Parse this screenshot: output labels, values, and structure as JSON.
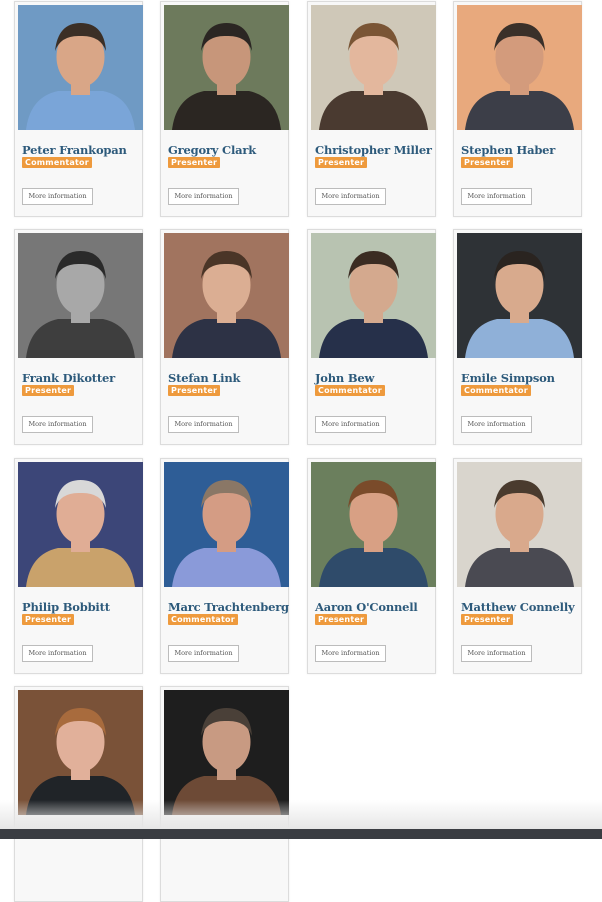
{
  "more_label": "More information",
  "colors": {
    "name": "#2d5a7b",
    "badge": "#ee9a3d",
    "footer": "#3a3d42"
  },
  "people": [
    {
      "name": "Peter Frankopan",
      "role": "Commentator",
      "bg": "#6f9ac4",
      "skin": "#d9a687",
      "hair": "#3b2f26",
      "shirt": "#7aa5d8"
    },
    {
      "name": "Gregory Clark",
      "role": "Presenter",
      "bg": "#6d7a5c",
      "skin": "#c7967a",
      "hair": "#2b2623",
      "shirt": "#2b2622"
    },
    {
      "name": "Christopher Miller",
      "role": "Presenter",
      "bg": "#cfc8b8",
      "skin": "#e3b79d",
      "hair": "#7a5535",
      "shirt": "#4a3a30"
    },
    {
      "name": "Stephen Haber",
      "role": "Presenter",
      "bg": "#e8a97d",
      "skin": "#d39b7c",
      "hair": "#3a3029",
      "shirt": "#3c3e48"
    },
    {
      "name": "Frank Dikotter",
      "role": "Presenter",
      "bg": "#777777",
      "skin": "#a8a8a8",
      "hair": "#2a2a2a",
      "shirt": "#3e3e3e"
    },
    {
      "name": "Stefan Link",
      "role": "Presenter",
      "bg": "#a1745f",
      "skin": "#dbae93",
      "hair": "#4a3527",
      "shirt": "#2d3245"
    },
    {
      "name": "John Bew",
      "role": "Commentator",
      "bg": "#b8c3b1",
      "skin": "#d4a98e",
      "hair": "#3b2c22",
      "shirt": "#26304a"
    },
    {
      "name": "Emile Simpson",
      "role": "Commentator",
      "bg": "#2e3236",
      "skin": "#d8aa8d",
      "hair": "#2a2420",
      "shirt": "#8fb0d8"
    },
    {
      "name": "Philip Bobbitt",
      "role": "Presenter",
      "bg": "#3c4678",
      "skin": "#e0ad95",
      "hair": "#d8d8d8",
      "shirt": "#c9a26b"
    },
    {
      "name": "Marc Trachtenberg",
      "role": "Commentator",
      "bg": "#2e5d96",
      "skin": "#d49c84",
      "hair": "#8a7766",
      "shirt": "#8a9ad9"
    },
    {
      "name": "Aaron O'Connell",
      "role": "Presenter",
      "bg": "#6b7f5d",
      "skin": "#d8a084",
      "hair": "#7a4b2a",
      "shirt": "#2f4b6a"
    },
    {
      "name": "Matthew Connelly",
      "role": "Presenter",
      "bg": "#d9d5cd",
      "skin": "#d9a98c",
      "hair": "#4a3b2e",
      "shirt": "#4a4a52"
    },
    {
      "name": "",
      "role": "",
      "bg": "#7a5238",
      "skin": "#e1b09a",
      "hair": "#a86b3d",
      "shirt": "#202428"
    },
    {
      "name": "",
      "role": "",
      "bg": "#1e1e1e",
      "skin": "#c89a82",
      "hair": "#4a4038",
      "shirt": "#6d4a36"
    }
  ]
}
